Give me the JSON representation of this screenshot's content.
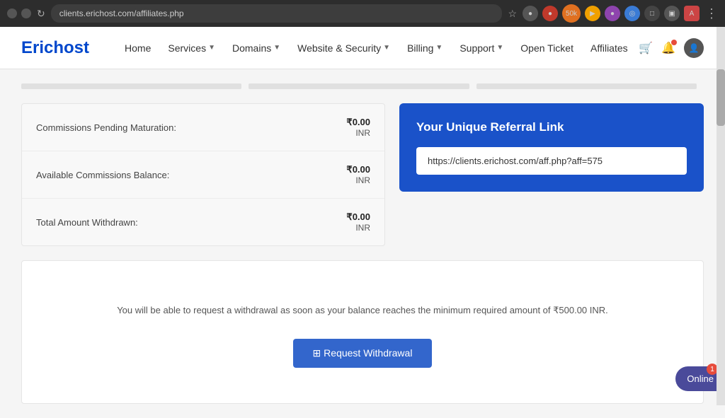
{
  "browser": {
    "url": "clients.erichost.com/affiliates.php",
    "star": "☆",
    "refresh": "↻",
    "dots": "⋮"
  },
  "navbar": {
    "logo": "Erichost",
    "links": [
      {
        "label": "Home",
        "hasDropdown": false
      },
      {
        "label": "Services",
        "hasDropdown": true
      },
      {
        "label": "Domains",
        "hasDropdown": true
      },
      {
        "label": "Website & Security",
        "hasDropdown": true
      },
      {
        "label": "Billing",
        "hasDropdown": true
      },
      {
        "label": "Support",
        "hasDropdown": true
      },
      {
        "label": "Open Ticket",
        "hasDropdown": false
      },
      {
        "label": "Affiliates",
        "hasDropdown": false
      }
    ]
  },
  "commissions": {
    "rows": [
      {
        "label": "Commissions Pending Maturation:",
        "amount": "₹0.00",
        "currency": "INR"
      },
      {
        "label": "Available Commissions Balance:",
        "amount": "₹0.00",
        "currency": "INR"
      },
      {
        "label": "Total Amount Withdrawn:",
        "amount": "₹0.00",
        "currency": "INR"
      }
    ]
  },
  "referral": {
    "title": "Your Unique Referral Link",
    "link": "https://clients.erichost.com/aff.php?aff=575"
  },
  "withdrawal": {
    "info": "You will be able to request a withdrawal as soon as your balance reaches the minimum required amount of ₹500.00 INR.",
    "button_label": "⊞ Request Withdrawal"
  },
  "chat": {
    "label": "Online",
    "count": "1"
  }
}
